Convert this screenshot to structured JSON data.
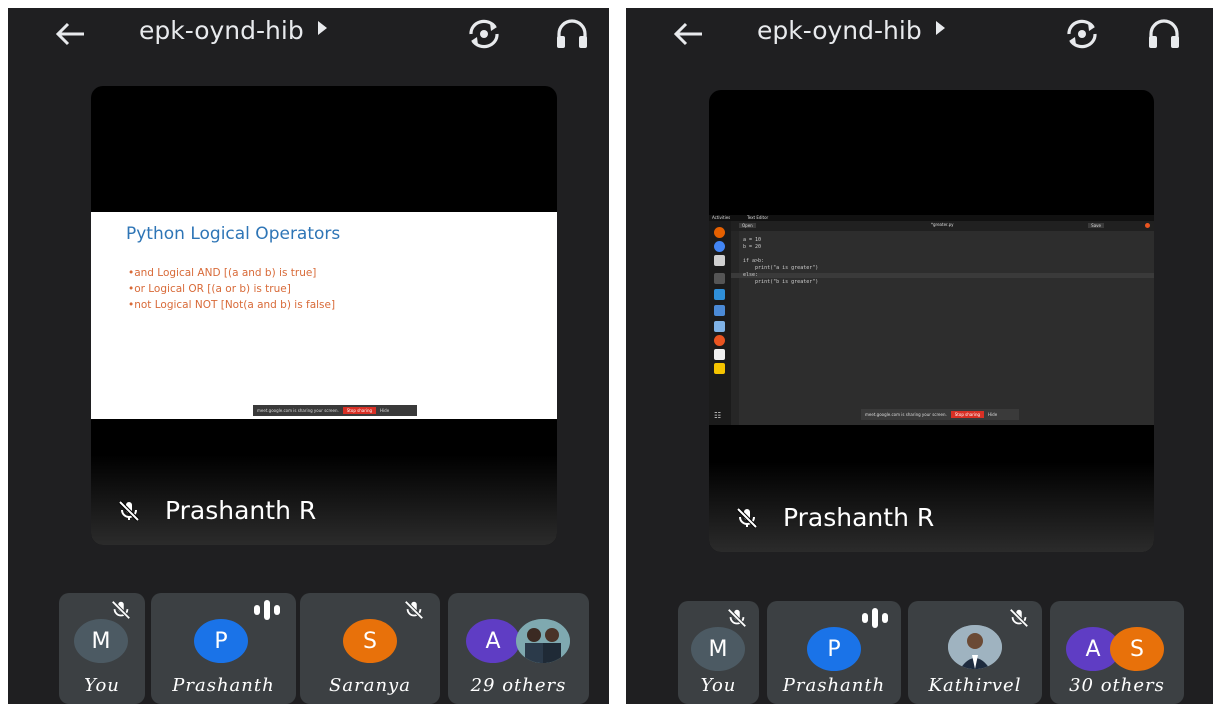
{
  "left": {
    "meeting_code": "epk-oynd-hib",
    "presenter": "Prashanth R",
    "slide": {
      "title": "Python Logical Operators",
      "bullets": [
        "•and Logical AND [(a and b) is true]",
        "•or Logical OR [(a or b) is true]",
        "•not Logical NOT [Not(a and b) is false]"
      ],
      "share_text": "meet.google.com is sharing your screen.",
      "stop_label": "Stop sharing",
      "hide_label": "Hide"
    },
    "participants": [
      {
        "initial": "M",
        "label": "You",
        "color": "#4c5a63"
      },
      {
        "initial": "P",
        "label": "Prashanth",
        "color": "#1a73e8"
      },
      {
        "initial": "S",
        "label": "Saranya",
        "color": "#e8710a"
      },
      {
        "initial": "A",
        "label": "29 others",
        "color": "#5f3dc4"
      }
    ]
  },
  "right": {
    "meeting_code": "epk-oynd-hib",
    "presenter": "Prashanth R",
    "editor": {
      "activities": "Activities",
      "app": "Text Editor",
      "file": "*greater.py",
      "open_label": "Open",
      "save_label": "Save",
      "code": "a = 10\nb = 20\n\nif a>b:\n    print(\"a is greater\")\nelse:\n    print(\"b is greater\")",
      "share_text": "meet.google.com is sharing your screen.",
      "stop_label": "Stop sharing",
      "hide_label": "Hide"
    },
    "participants": [
      {
        "initial": "M",
        "label": "You",
        "color": "#4c5a63"
      },
      {
        "initial": "P",
        "label": "Prashanth",
        "color": "#1a73e8"
      },
      {
        "initial": "",
        "label": "Kathirvel",
        "color": "#8a9aa4"
      },
      {
        "initial": "A",
        "initial2": "S",
        "label": "30 others",
        "color": "#5f3dc4",
        "color2": "#e8710a"
      }
    ]
  }
}
